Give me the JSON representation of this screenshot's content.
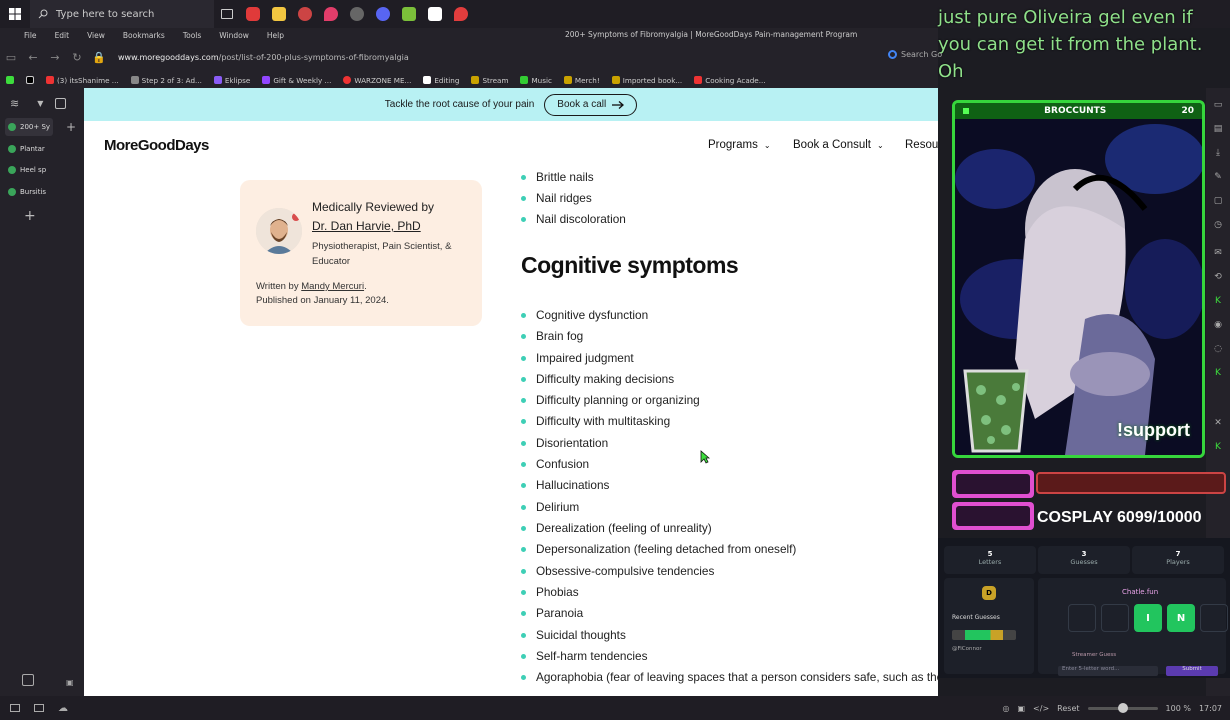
{
  "taskbar": {
    "search_placeholder": "Type here to search"
  },
  "browser": {
    "menu": [
      "File",
      "Edit",
      "View",
      "Bookmarks",
      "Tools",
      "Window",
      "Help"
    ],
    "window_title": "200+ Symptoms of Fibromyalgia | MoreGoodDays Pain-management Program",
    "url_domain": "www.moregooddays.com",
    "url_path": "/post/list-of-200-plus-symptoms-of-fibromyalgia",
    "search_web_label": "Search Go",
    "bookmarks": [
      "(3) itsShanime ...",
      "Step 2 of 3: Ad...",
      "Eklipse",
      "Gift & Weekly ...",
      "WARZONE ME...",
      "Editing",
      "Stream",
      "Music",
      "Merch!",
      "Imported book...",
      "Cooking Acade..."
    ],
    "panel_tabs": [
      "200+ Sy",
      "Plantar",
      "Heel sp",
      "Bursitis"
    ],
    "zoom_reset": "Reset",
    "zoom_level": "100 %",
    "zoom_fraction": 0.5,
    "clock": "17:07"
  },
  "site": {
    "banner_text": "Tackle the root cause of your pain",
    "banner_button": "Book a call",
    "logo": "MoreGoodDays",
    "nav": [
      "Programs",
      "Book a Consult",
      "Resource"
    ]
  },
  "review_card": {
    "title": "Medically Reviewed by",
    "reviewer": "Dr. Dan Harvie, PhD",
    "role": "Physiotherapist, Pain Scientist, & Educator",
    "written_prefix": "Written by",
    "author": "Mandy Mercuri",
    "published": "Published on January 11, 2024."
  },
  "article": {
    "pre_items": [
      "Brittle nails",
      "Nail ridges",
      "Nail discoloration"
    ],
    "heading": "Cognitive symptoms",
    "items": [
      "Cognitive dysfunction",
      "Brain fog",
      "Impaired judgment",
      "Difficulty making decisions",
      "Difficulty planning or organizing",
      "Difficulty with multitasking",
      "Disorientation",
      "Confusion",
      "Hallucinations",
      "Delirium",
      "Derealization (feeling of unreality)",
      "Depersonalization (feeling detached from oneself)",
      "Obsessive-compulsive tendencies",
      "Phobias",
      "Paranoia",
      "Suicidal thoughts",
      "Self-harm tendencies",
      "Agoraphobia (fear of leaving spaces that a person considers safe, such as their home)"
    ]
  },
  "stream_overlay": {
    "caption": "just pure Oliveira gel even if you can get it from the plant. Oh",
    "cam_label": "BROCCUNTS",
    "cam_number": "20",
    "support": "!support",
    "cosplay_goal": "COSPLAY 6099/10000",
    "game": {
      "stats": [
        {
          "value": "5",
          "label": "Letters"
        },
        {
          "value": "3",
          "label": "Guesses"
        },
        {
          "value": "7",
          "label": "Players"
        }
      ],
      "site": "Chatle.fun",
      "recent_label": "Recent Guesses",
      "recent_user": "@FiConnor",
      "streamer_label": "Streamer Guess",
      "input_placeholder": "Enter 5-letter word...",
      "submit": "Submit",
      "tiles": [
        "",
        "",
        "I",
        "N",
        ""
      ],
      "small_tile": "D"
    }
  },
  "colors": {
    "banner_bg": "#b8f1f3",
    "bullet": "#3ecfb6",
    "card_bg": "#fdeee2",
    "cam_border": "#36d63c",
    "caption": "#8fe08a"
  }
}
